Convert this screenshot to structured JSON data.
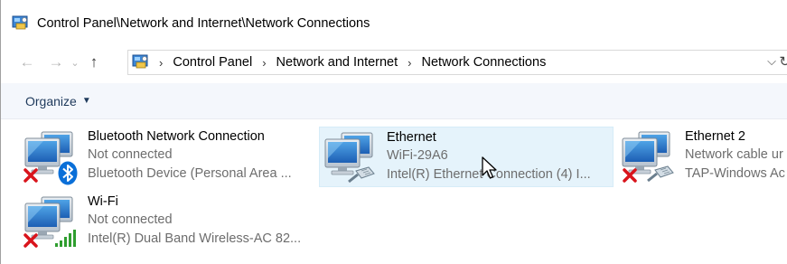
{
  "window": {
    "title": "Control Panel\\Network and Internet\\Network Connections"
  },
  "nav": {
    "back_icon": "back-arrow-icon",
    "forward_icon": "forward-arrow-icon",
    "recent_icon": "chevron-down-icon",
    "up_icon": "up-arrow-icon",
    "breadcrumb": [
      "Control Panel",
      "Network and Internet",
      "Network Connections"
    ]
  },
  "toolbar": {
    "organize_label": "Organize"
  },
  "connections": [
    {
      "name": "Bluetooth Network Connection",
      "status": "Not connected",
      "device": "Bluetooth Device (Personal Area ...",
      "overlay": "bluetooth-icon",
      "error": true,
      "selected": false
    },
    {
      "name": "Ethernet",
      "status": "WiFi-29A6",
      "device": "Intel(R) Ethernet Connection (4) I...",
      "overlay": "ethernet-cable-icon",
      "error": false,
      "selected": true
    },
    {
      "name": "Ethernet 2",
      "status": "Network cable ur",
      "device": "TAP-Windows Ac",
      "overlay": "ethernet-cable-icon",
      "error": true,
      "selected": false
    },
    {
      "name": "Wi-Fi",
      "status": "Not connected",
      "device": "Intel(R) Dual Band Wireless-AC 82...",
      "overlay": "wifi-signal-icon",
      "error": true,
      "selected": false
    }
  ],
  "colors": {
    "selection_bg": "#e5f3fb",
    "command_bar_bg": "#f4f7fc",
    "organize_text": "#1e395b",
    "error_red": "#d9141c",
    "bluetooth_blue": "#0a6fd8",
    "wifi_green": "#2f9e2f"
  }
}
